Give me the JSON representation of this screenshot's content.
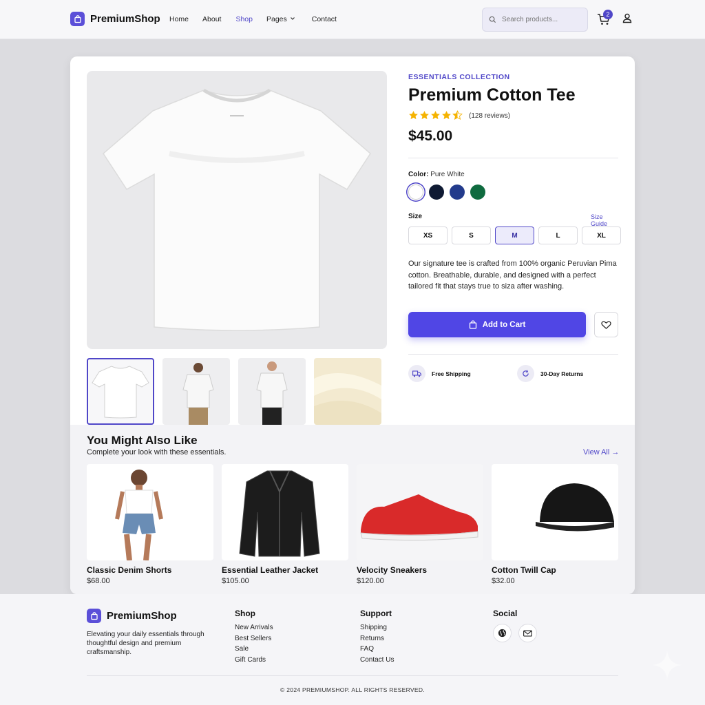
{
  "brand": {
    "name": "PremiumShop",
    "accent": "#5046e5"
  },
  "nav": {
    "items": [
      "Home",
      "About",
      "Shop",
      "Pages",
      "Contact"
    ],
    "active": "Shop"
  },
  "search": {
    "placeholder": "Search products..."
  },
  "cart": {
    "count": "2"
  },
  "product": {
    "collection": "ESSENTIALS COLLECTION",
    "title": "Premium Cotton Tee",
    "rating": 4.5,
    "reviews": "(128 reviews)",
    "price": "$45.00",
    "color_label": "Color:",
    "color_value": "Pure White",
    "colors": [
      "#ffffff",
      "#0f1a33",
      "#233b8c",
      "#0f6b3f"
    ],
    "size_label": "Size",
    "size_guide": "Size Guide",
    "sizes": [
      "XS",
      "S",
      "M",
      "L",
      "XL"
    ],
    "selected_size": "M",
    "description": "Our signature tee is crafted from 100% organic Peruvian Pima cotton. Breathable, durable, and designed with a perfect tailored fit that stays true to siza after washing.",
    "add_to_cart": "Add to Cart",
    "perks": [
      "Free Shipping",
      "30-Day Returns"
    ]
  },
  "related": {
    "title": "You Might Also Like",
    "subtitle": "Complete your look with these essentials.",
    "view_all": "View All →",
    "items": [
      {
        "name": "Classic Denim Shorts",
        "price": "$68.00"
      },
      {
        "name": "Essential Leather Jacket",
        "price": "$105.00"
      },
      {
        "name": "Velocity Sneakers",
        "price": "$120.00"
      },
      {
        "name": "Cotton Twill Cap",
        "price": "$32.00"
      }
    ]
  },
  "footer": {
    "brand": "PremiumShop",
    "description": "Elevating your daily essentials through thoughtful design and premium craftsmanship.",
    "shop": {
      "title": "Shop",
      "links": [
        "New Arrivals",
        "Best Sellers",
        "Sale",
        "Gift Cards"
      ]
    },
    "support": {
      "title": "Support",
      "links": [
        "Shipping",
        "Returns",
        "FAQ",
        "Contact Us"
      ]
    },
    "social": {
      "title": "Social",
      "icons": [
        "globe-icon",
        "mail-icon"
      ]
    },
    "copyright": "© 2024 PREMIUMSHOP. ALL RIGHTS RESERVED."
  }
}
